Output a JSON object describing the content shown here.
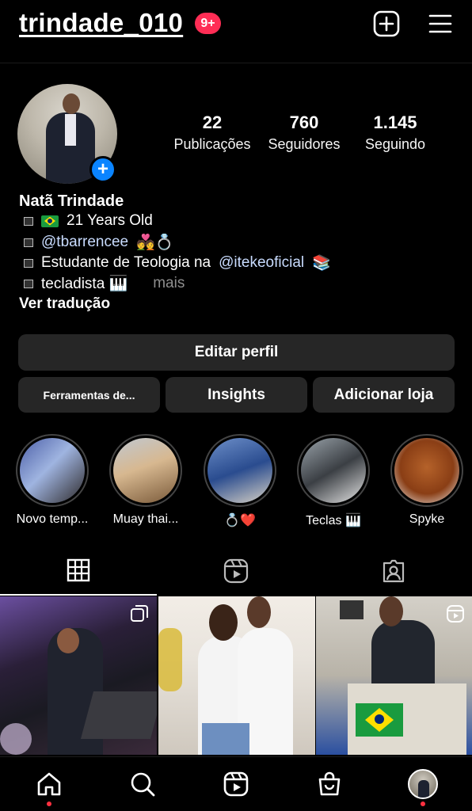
{
  "header": {
    "username": "trindade_010",
    "notifications": "9+"
  },
  "profile": {
    "stats": [
      {
        "value": "22",
        "label": "Publicações"
      },
      {
        "value": "760",
        "label": "Seguidores"
      },
      {
        "value": "1.145",
        "label": "Seguindo"
      }
    ],
    "display_name": "Natã Trindade",
    "bio": {
      "line1": "21 Years Old",
      "line2_mention": "@tbarrencee",
      "line2_emoji": "💑💍",
      "line3_prefix": "Estudante de Teologia na",
      "line3_mention": "@itekeoficial",
      "line3_emoji": "📚",
      "line4": "tecladista 🎹",
      "more": "mais"
    },
    "translate": "Ver tradução"
  },
  "buttons": {
    "edit": "Editar perfil",
    "tools": "Ferramentas de...",
    "insights": "Insights",
    "shop": "Adicionar loja"
  },
  "highlights": [
    {
      "label": "Novo temp..."
    },
    {
      "label": "Muay thai..."
    },
    {
      "label": "💍❤️"
    },
    {
      "label": "Teclas 🎹"
    },
    {
      "label": "Spyke"
    }
  ],
  "colors": {
    "accent": "#0a84ff",
    "badge": "#ff2d55",
    "button_bg": "#262626"
  },
  "icons": [
    "plus-square-icon",
    "menu-icon",
    "grid-icon",
    "reels-icon",
    "tagged-icon",
    "home-icon",
    "search-icon",
    "reels-nav-icon",
    "shop-icon"
  ]
}
